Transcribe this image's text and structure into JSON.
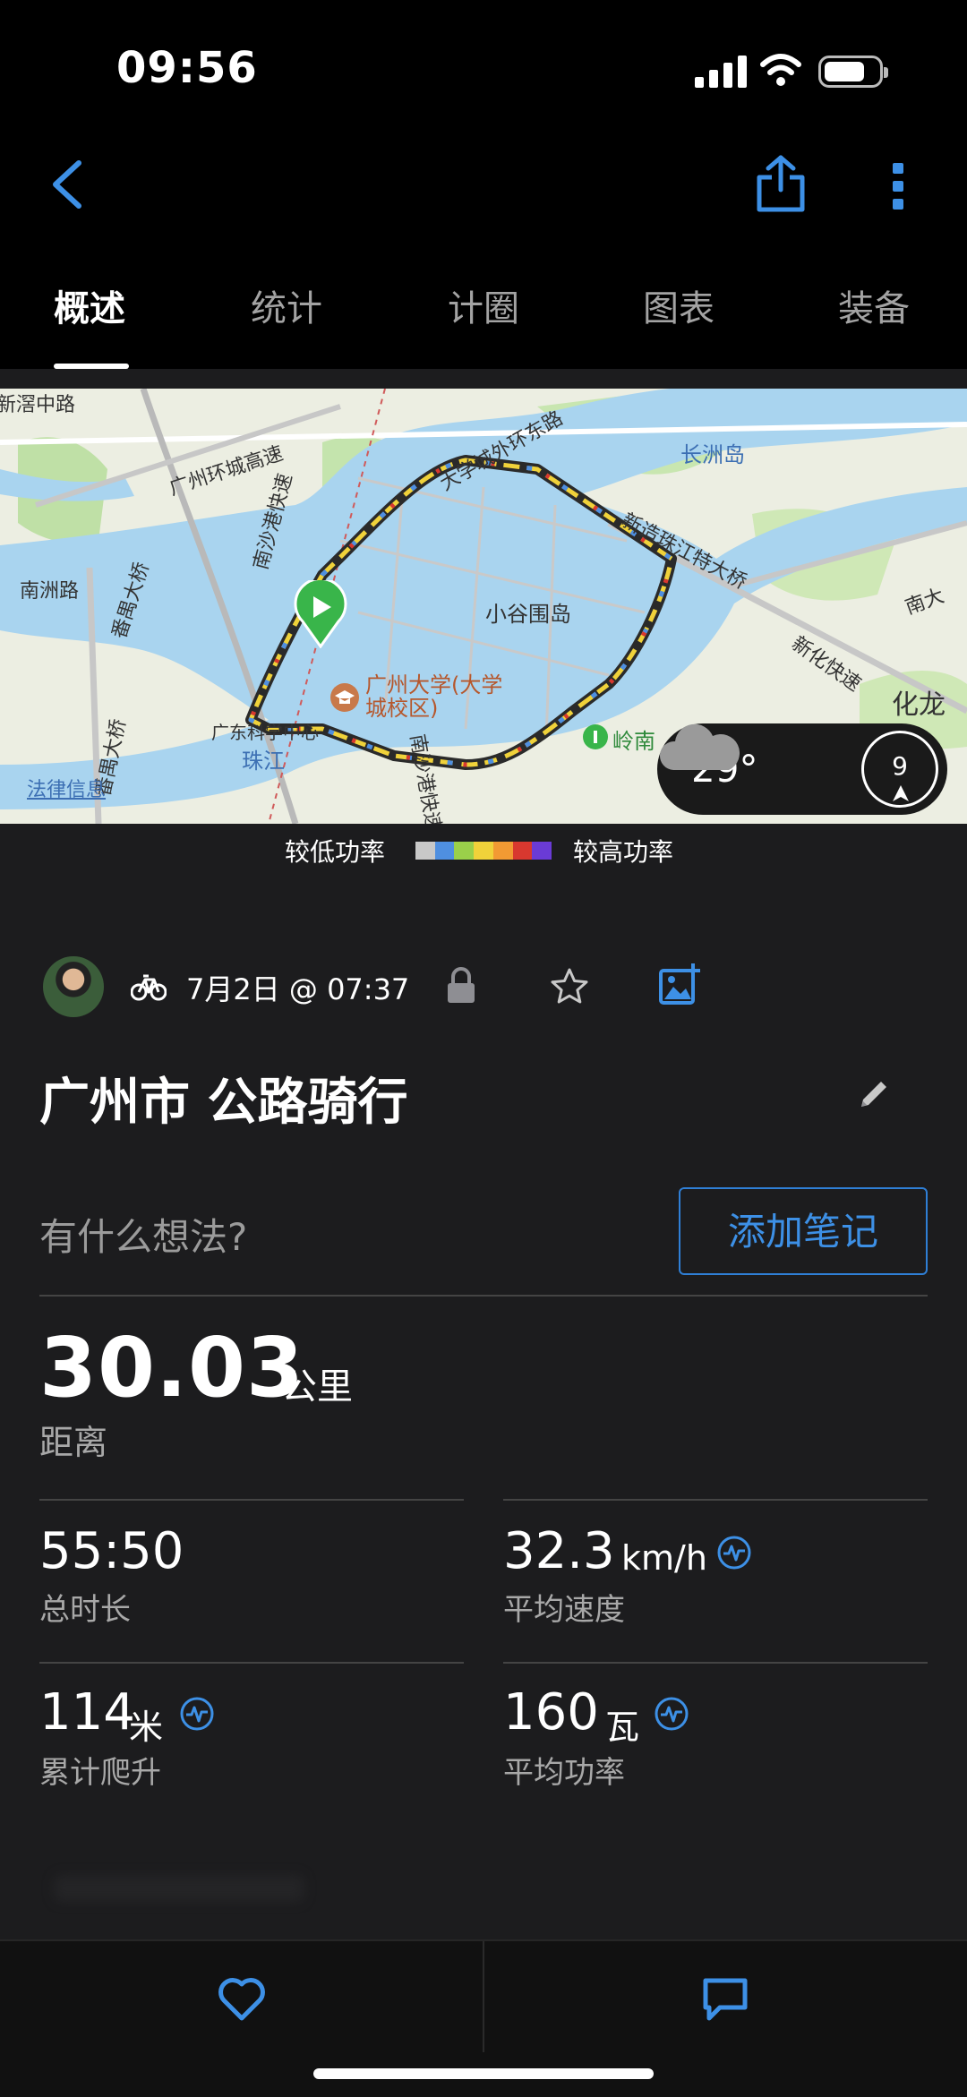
{
  "status_bar": {
    "time": "09:56"
  },
  "tabs": [
    {
      "label": "概述",
      "active": true
    },
    {
      "label": "统计",
      "active": false
    },
    {
      "label": "计圈",
      "active": false
    },
    {
      "label": "图表",
      "active": false
    },
    {
      "label": "装备",
      "active": false
    }
  ],
  "map": {
    "labels": {
      "xinzhou_rd": "新滘中路",
      "ring_expressway": "广州环城高速",
      "nansha_expressway_north": "南沙港快速",
      "nanzhou_rd": "南洲路",
      "panyu_bridge_1": "番禺大桥",
      "panyu_bridge_2": "番禺大桥",
      "outer_ring_east": "大学城外环东路",
      "changzhou_island": "长洲岛",
      "xinzao_bridge": "新造珠江特大桥",
      "xiaoguwei_island": "小谷围岛",
      "gz_university": "广州大学(大学城校区)",
      "science_center": "广东科学中心",
      "zhujiang": "珠江",
      "nansha_expressway_south": "南沙港快速",
      "lingnan": "岭南",
      "nanda": "南大",
      "xinhua_expressway": "新化快速",
      "hualong": "化龙",
      "legal_info": "法律信息"
    },
    "weather": {
      "temperature": "29°",
      "wind_speed": "9",
      "icon": "cloud-icon"
    }
  },
  "legend": {
    "low_label": "较低功率",
    "high_label": "较高功率",
    "colors": [
      "#c8c8c8",
      "#4f8fe0",
      "#9ad04a",
      "#f0d23a",
      "#f29a33",
      "#d8382f",
      "#6a3bd6"
    ]
  },
  "activity": {
    "date": "7月2日 @ 07:37",
    "title": "广州市 公路骑行",
    "thoughts_placeholder": "有什么想法?",
    "add_note_label": "添加笔记"
  },
  "stats": {
    "distance": {
      "value": "30.03",
      "unit": "公里",
      "label": "距离"
    },
    "total_time": {
      "value": "55:50",
      "label": "总时长"
    },
    "avg_speed": {
      "value": "32.3",
      "unit": "km/h",
      "label": "平均速度"
    },
    "elevation_gain": {
      "value": "114",
      "unit": "米",
      "label": "累计爬升"
    },
    "avg_power": {
      "value": "160",
      "unit": "瓦",
      "label": "平均功率"
    }
  },
  "colors": {
    "accent": "#3d90e6",
    "background": "#1c1c1e",
    "top_bar": "#000000"
  }
}
